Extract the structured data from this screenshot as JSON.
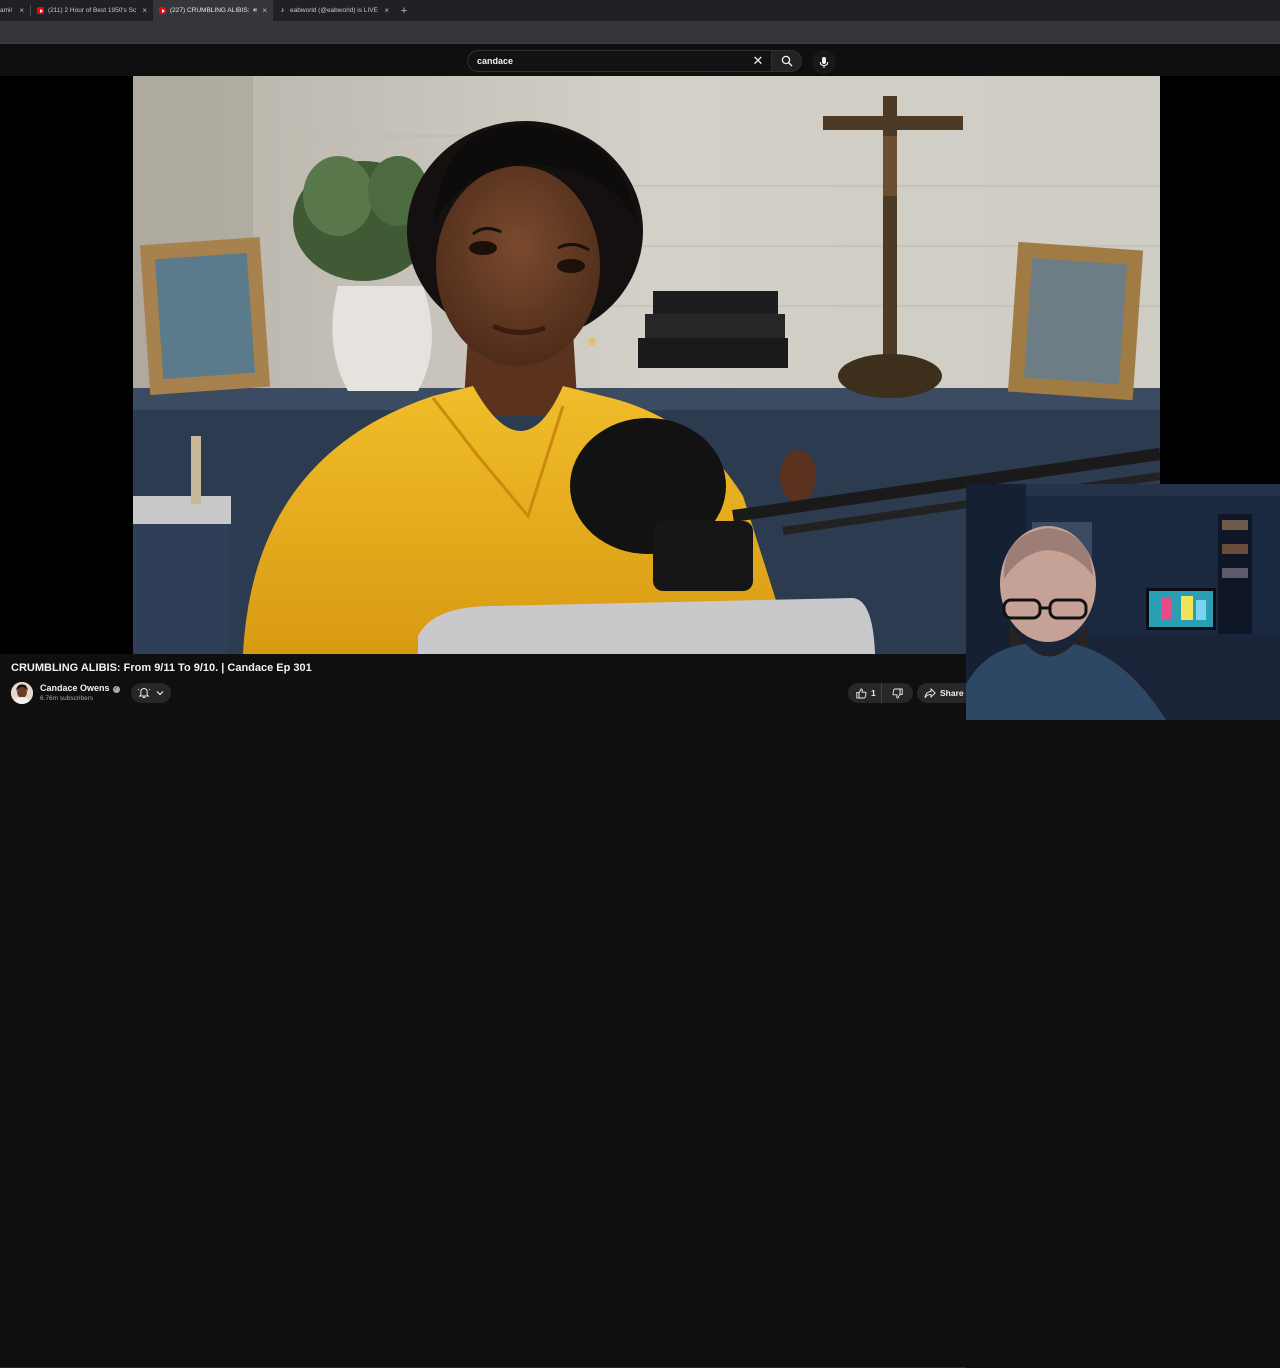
{
  "browser": {
    "tabs": [
      {
        "title": "amil",
        "favicon": "generic",
        "active": false
      },
      {
        "title": "(211) 2 Hour of Best 1950's Sc",
        "favicon": "youtube-icon",
        "active": false
      },
      {
        "title": "(227) CRUMBLING ALIBIS: F",
        "favicon": "youtube-icon",
        "active": true,
        "audio": true
      },
      {
        "title": "eabworld (@eabworld) is LIVE",
        "favicon": "tiktok-icon",
        "active": false
      }
    ],
    "close_glyph": "×",
    "new_tab_glyph": "+"
  },
  "search": {
    "value": "candace",
    "clear_icon": "close-icon",
    "search_icon": "search-icon",
    "voice_icon": "microphone-icon"
  },
  "video": {
    "title": "CRUMBLING ALIBIS: From 9/11 To 9/10. | Candace Ep 301",
    "channel": "Candace Owens",
    "subscribers": "6.76m subscribers",
    "verified_icon": "verified-check-icon",
    "subscribe_icons": [
      "bell-icon",
      "chevron-down-icon"
    ],
    "likes": "1",
    "share_label": "Share",
    "icons": {
      "like": "thumbs-up-icon",
      "dislike": "thumbs-down-icon",
      "share": "share-arrow-icon"
    }
  },
  "colors": {
    "background": "#0f0f0f",
    "tabstrip": "#202124",
    "active_tab": "#35363a",
    "button": "#272727",
    "youtube_red": "#ff0000",
    "blouse_yellow": "#e8b020"
  }
}
